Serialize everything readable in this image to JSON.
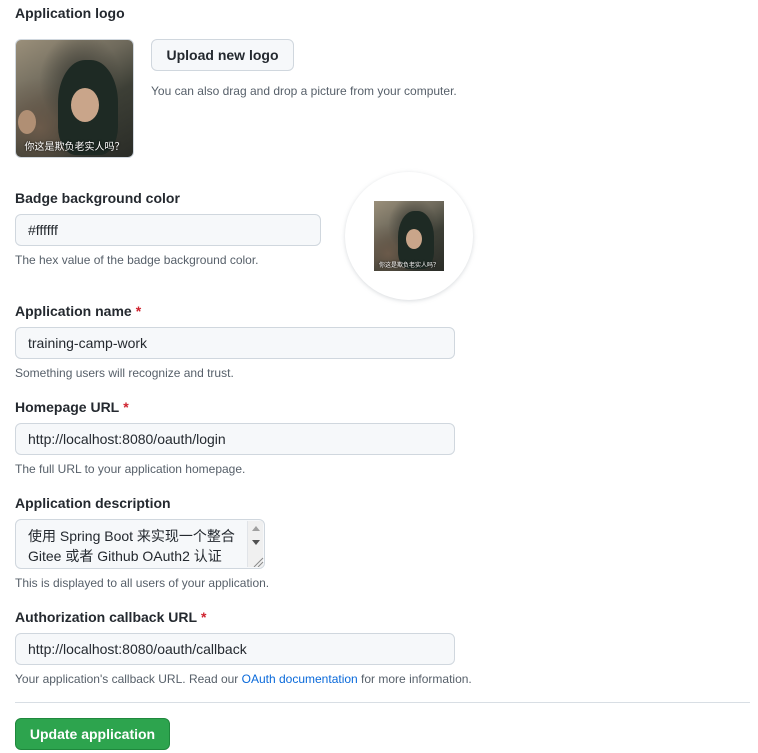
{
  "logo_section": {
    "label": "Application logo",
    "upload_button": "Upload new logo",
    "drag_hint": "You can also drag and drop a picture from your computer.",
    "image_caption": "你这是欺负老实人吗？"
  },
  "badge": {
    "label": "Badge background color",
    "value": "#ffffff",
    "hint": "The hex value of the badge background color.",
    "preview_caption": "你这是欺负老实人吗？"
  },
  "app_name": {
    "label": "Application name",
    "required_mark": "*",
    "value": "training-camp-work",
    "hint": "Something users will recognize and trust."
  },
  "homepage": {
    "label": "Homepage URL",
    "required_mark": "*",
    "value": "http://localhost:8080/oauth/login",
    "hint": "The full URL to your application homepage."
  },
  "description": {
    "label": "Application description",
    "line1": "使用 Spring Boot 来实现一个整合",
    "line2": "Gitee 或者 Github OAuth2 认证",
    "hint": "This is displayed to all users of your application."
  },
  "callback": {
    "label": "Authorization callback URL",
    "required_mark": "*",
    "value": "http://localhost:8080/oauth/callback",
    "hint_before": "Your application's callback URL. Read our ",
    "hint_link": "OAuth documentation",
    "hint_after": " for more information."
  },
  "submit": {
    "label": "Update application"
  },
  "colors": {
    "accent_green": "#2da44e",
    "required_red": "#cf222e",
    "link_blue": "#0969da"
  }
}
